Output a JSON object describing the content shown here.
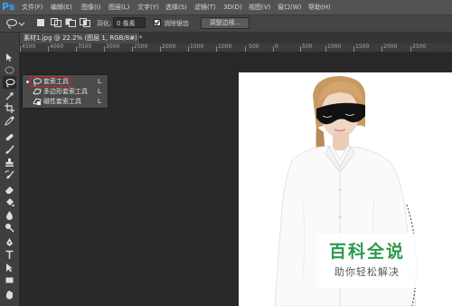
{
  "app": {
    "logo": "Ps",
    "logo_color": "#31a8ff"
  },
  "menu": [
    "文件(F)",
    "编辑(E)",
    "图像(I)",
    "图层(L)",
    "文字(Y)",
    "选择(S)",
    "滤镜(T)",
    "3D(D)",
    "视图(V)",
    "窗口(W)",
    "帮助(H)"
  ],
  "options": {
    "feather_label": "羽化:",
    "feather_value": "0 像素",
    "antialias_label": "消除锯齿",
    "antialias_checked": true,
    "refine_edge_button": "调整边缘..."
  },
  "document": {
    "tab_title": "素材1.jpg @ 22.2% (图层 1, RGB/8#) *",
    "close_label": "×"
  },
  "ruler": {
    "labels": [
      "4500",
      "4000",
      "3500",
      "3000",
      "2500",
      "2000",
      "1500",
      "1000",
      "500",
      "0",
      "500",
      "1000",
      "1500",
      "2000",
      "2500"
    ]
  },
  "flyout": {
    "items": [
      {
        "label": "套索工具",
        "shortcut": "L",
        "icon": "lasso-icon",
        "selected": true
      },
      {
        "label": "多边形套索工具",
        "shortcut": "L",
        "icon": "polygonal-lasso-icon",
        "selected": false
      },
      {
        "label": "磁性套索工具",
        "shortcut": "L",
        "icon": "magnetic-lasso-icon",
        "selected": false
      }
    ],
    "highlight_color": "#e02020"
  },
  "watermark": {
    "title": "百科全说",
    "subtitle": "助你轻松解决",
    "title_color": "#2b9a4b"
  },
  "tools": [
    "move-icon",
    "marquee-icon",
    "lasso-icon",
    "magic-wand-icon",
    "crop-icon",
    "eyedropper-icon",
    "healing-brush-icon",
    "brush-icon",
    "clone-stamp-icon",
    "history-brush-icon",
    "eraser-icon",
    "gradient-icon",
    "blur-icon",
    "dodge-icon",
    "pen-icon",
    "type-icon",
    "path-selection-icon",
    "rectangle-shape-icon",
    "hand-icon"
  ]
}
